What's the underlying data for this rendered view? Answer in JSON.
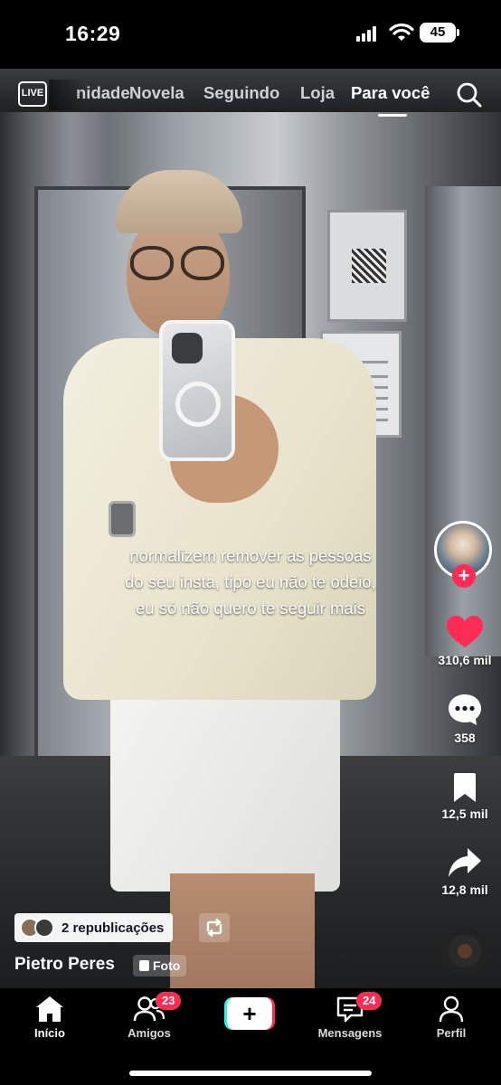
{
  "status_bar": {
    "time": "16:29",
    "battery": "45"
  },
  "top_nav": {
    "live_label": "LIVE",
    "tabs": [
      {
        "label": "nidade"
      },
      {
        "label": "Novela"
      },
      {
        "label": "Seguindo"
      },
      {
        "label": "Loja"
      },
      {
        "label": "Para você",
        "active": true
      }
    ]
  },
  "post": {
    "caption_lines": [
      "normalizem remover as pessoas",
      "do seu insta, tipo eu não te odeio,",
      "eu só não quero te seguir mais"
    ],
    "likes": "310,6 mil",
    "comments": "358",
    "saves": "12,5 mil",
    "shares": "12,8 mil",
    "reposts_label": "2 republicações",
    "author": "Pietro Peres",
    "type_badge": "Foto"
  },
  "bottom_nav": {
    "home": "Início",
    "friends": "Amigos",
    "friends_badge": "23",
    "create": "+",
    "messages": "Mensagens",
    "messages_badge": "24",
    "profile": "Perfil"
  },
  "colors": {
    "accent": "#fe2c55",
    "cyan": "#25f4ee",
    "background": "#000000"
  },
  "icons": [
    "live-icon",
    "search-icon",
    "heart-icon",
    "comment-icon",
    "bookmark-icon",
    "share-icon",
    "repost-icon",
    "home-icon",
    "friends-icon",
    "messages-icon",
    "profile-icon",
    "plus-icon"
  ]
}
